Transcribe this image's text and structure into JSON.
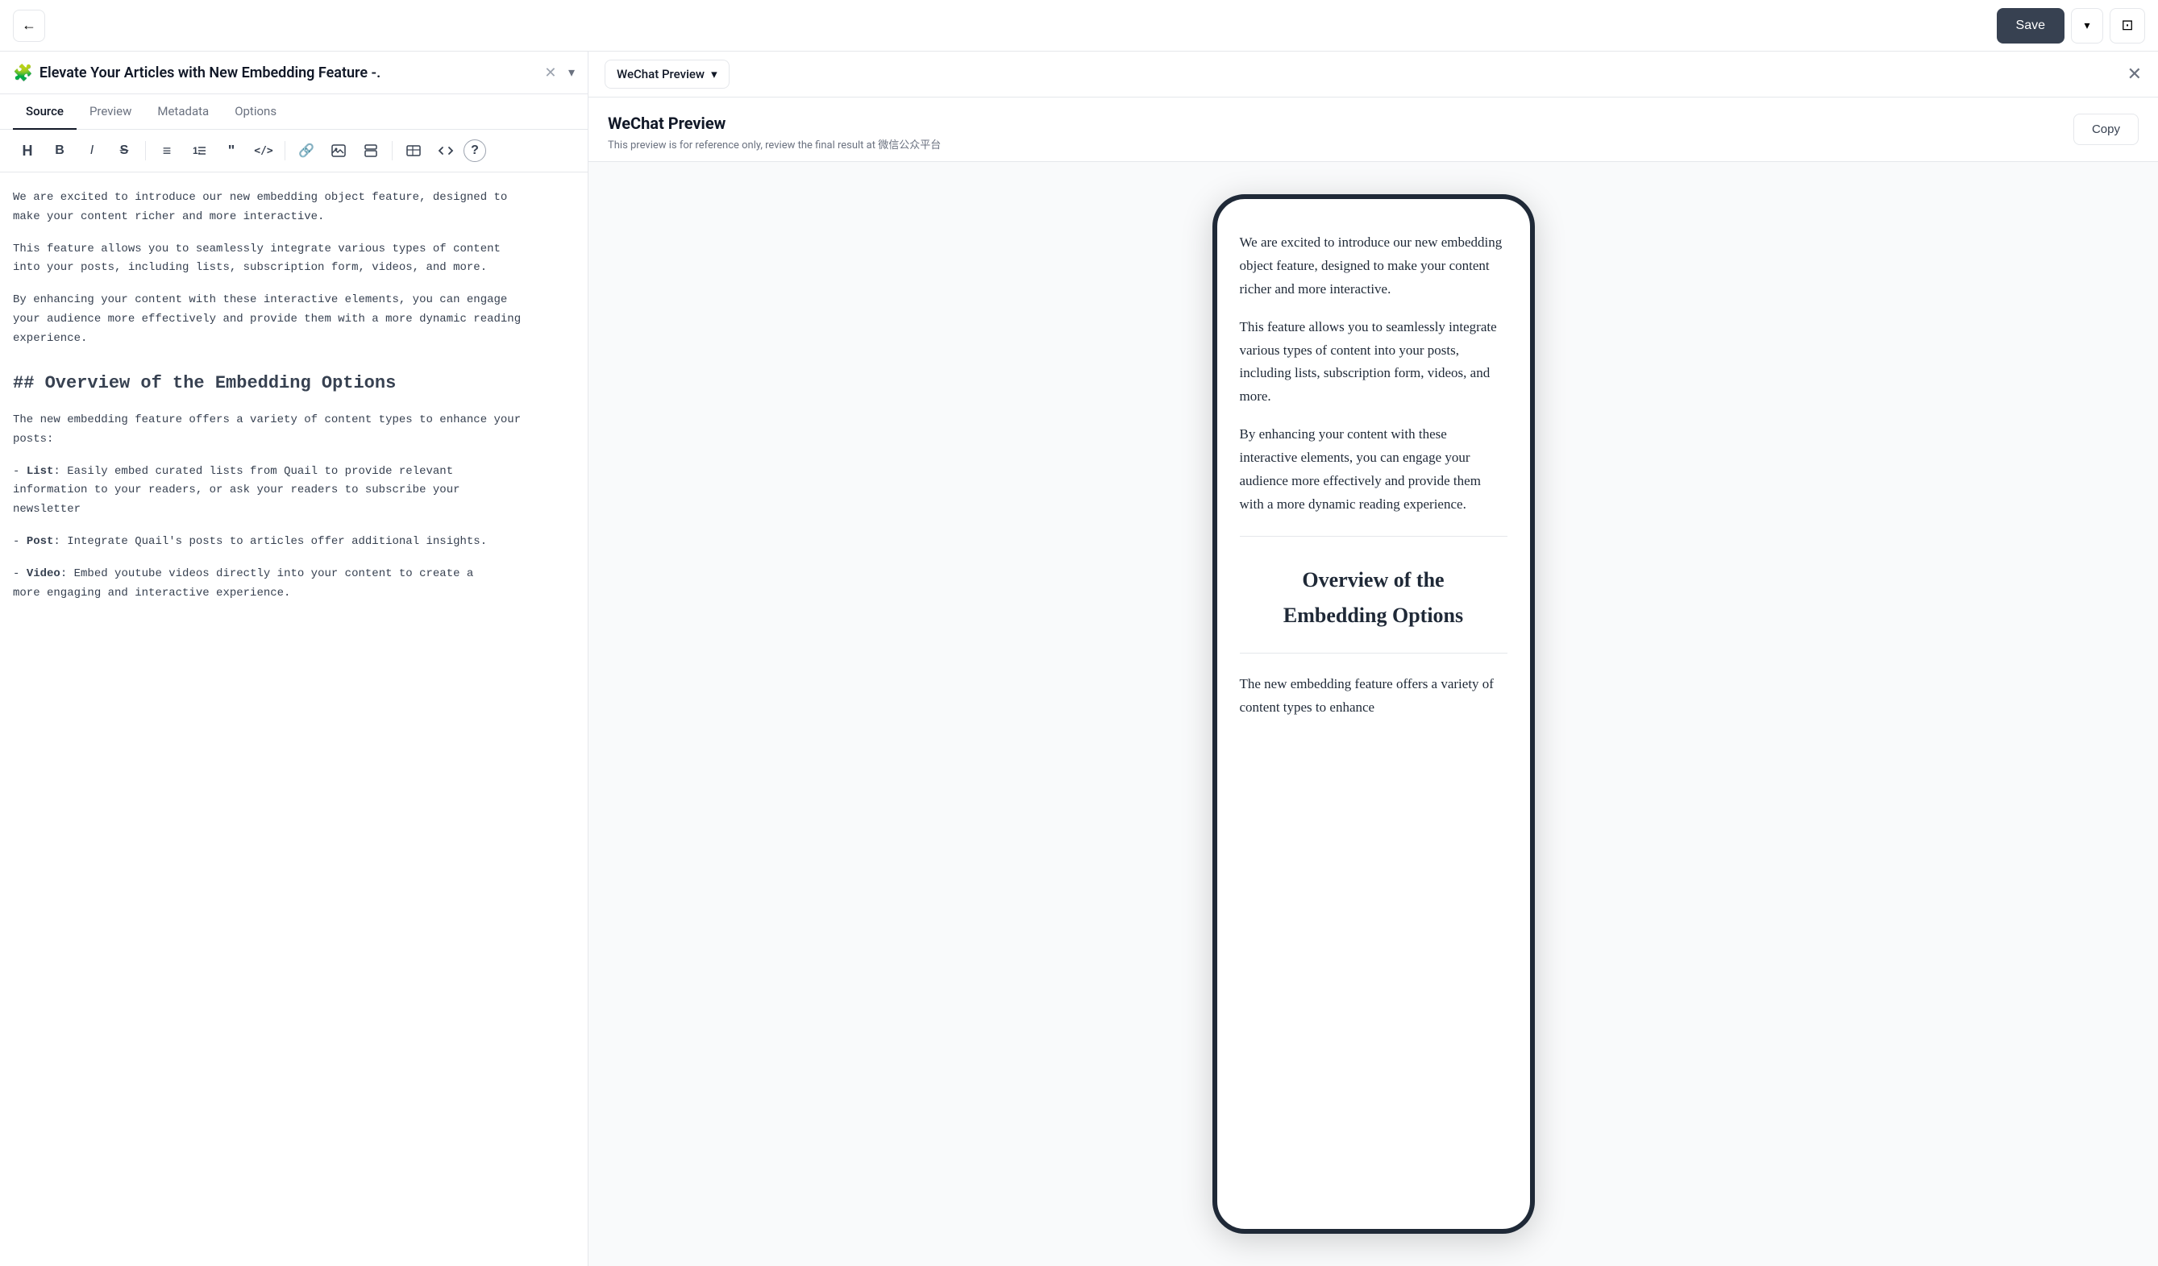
{
  "topbar": {
    "back_label": "←",
    "save_label": "Save",
    "dropdown_label": "▾",
    "layout_label": "⊡"
  },
  "article": {
    "icon": "🧩",
    "title": "Elevate Your Articles with New Embedding Feature -.",
    "clear_label": "✕",
    "chevron_label": "▾"
  },
  "tabs": [
    {
      "label": "Source",
      "active": true
    },
    {
      "label": "Preview",
      "active": false
    },
    {
      "label": "Metadata",
      "active": false
    },
    {
      "label": "Options",
      "active": false
    }
  ],
  "toolbar": {
    "buttons": [
      {
        "name": "heading",
        "label": "H",
        "title": "Heading"
      },
      {
        "name": "bold",
        "label": "B",
        "title": "Bold"
      },
      {
        "name": "italic",
        "label": "I",
        "title": "Italic"
      },
      {
        "name": "strikethrough",
        "label": "S̶",
        "title": "Strikethrough"
      },
      {
        "name": "unordered-list",
        "label": "≡",
        "title": "Unordered List"
      },
      {
        "name": "ordered-list",
        "label": "⊟",
        "title": "Ordered List"
      },
      {
        "name": "blockquote",
        "label": "❝",
        "title": "Blockquote"
      },
      {
        "name": "code",
        "label": "<>",
        "title": "Code"
      },
      {
        "name": "link",
        "label": "🔗",
        "title": "Link"
      },
      {
        "name": "image",
        "label": "🖼",
        "title": "Image"
      },
      {
        "name": "stack",
        "label": "⊕",
        "title": "Stack"
      },
      {
        "name": "table",
        "label": "⊞",
        "title": "Table"
      },
      {
        "name": "embed",
        "label": "⌘",
        "title": "Embed"
      },
      {
        "name": "help",
        "label": "?",
        "title": "Help"
      }
    ]
  },
  "editor": {
    "paragraphs": [
      "We are excited to introduce our new embedding object feature, designed to make your content richer and more interactive.",
      "This feature allows you to seamlessly integrate various types of content into your posts, including lists, subscription form, videos, and more.",
      "By enhancing your content with these interactive elements, you can engage your audience more effectively and provide them with a more dynamic reading experience."
    ],
    "heading": "## Overview of the Embedding Options",
    "paragraphs2": [
      "The new embedding feature offers a variety of content types to enhance your posts:"
    ],
    "list_items": [
      "- **List**: Easily embed curated lists from Quail to provide relevant information to your readers, or ask your readers to subscribe your newsletter",
      "- **Post**: Integrate Quail's posts to articles offer additional insights.",
      "- **Video**: Embed youtube videos directly into your content to create a more engaging and interactive experience."
    ]
  },
  "preview": {
    "selector_label": "WeChat Preview",
    "selector_chevron": "▾",
    "close_label": "✕",
    "header_title": "WeChat Preview",
    "header_subtitle": "This preview is for reference only, review the final result at 微信公众平台",
    "copy_label": "Copy",
    "phone_content": {
      "p1": "We are excited to introduce our new embedding object feature, designed to make your content richer and more interactive.",
      "p2": "This feature allows you to seamlessly integrate various types of content into your posts, including lists, subscription form, videos, and more.",
      "p3": "By enhancing your content with these interactive elements, you can engage your audience more effectively and provide them with a more dynamic reading experience.",
      "section_title": "Overview of the\nEmbedding Options",
      "p4": "The new embedding feature offers a variety of content types to enhance"
    }
  }
}
